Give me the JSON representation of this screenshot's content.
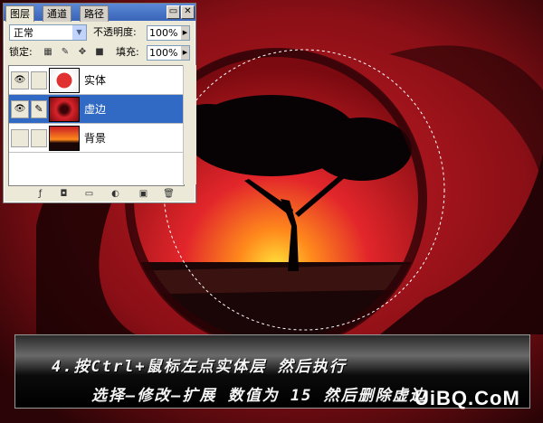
{
  "palette": {
    "tabs": [
      "图层",
      "通道",
      "路径"
    ],
    "blend_mode": "正常",
    "opacity_label": "不透明度:",
    "opacity_value": "100%",
    "lock_label": "锁定:",
    "fill_label": "填充:",
    "fill_value": "100%",
    "layers": [
      {
        "name": "实体",
        "visible": true,
        "selected": false
      },
      {
        "name": "虚边",
        "visible": true,
        "selected": true
      },
      {
        "name": "背景",
        "visible": false,
        "selected": false
      }
    ]
  },
  "caption": {
    "line1": "4.按Ctrl+鼠标左点实体层 然后执行",
    "line2": "选择—修改—扩展 数值为 15  然后删除虚边"
  },
  "watermark": "UiBQ.CoM",
  "colors": {
    "selection_highlight": "#316ac5",
    "sky_red": "#d8232a",
    "sun_yellow": "#ffd21a"
  }
}
